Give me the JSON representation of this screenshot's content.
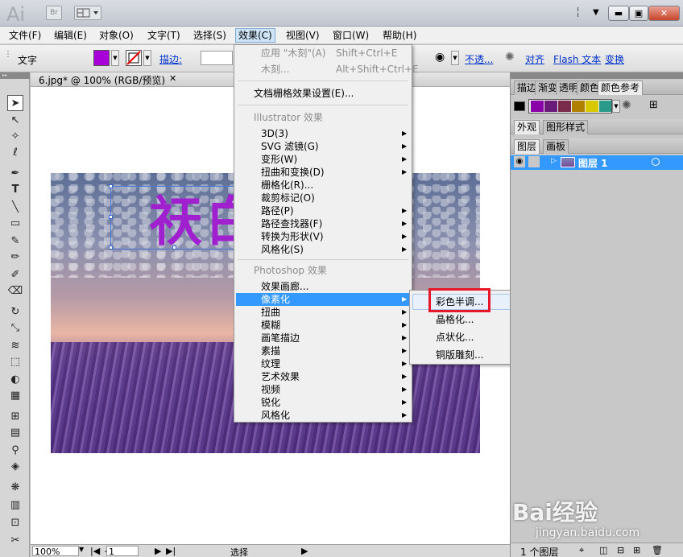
{
  "titlebar": {
    "logo": "Ai",
    "br": "Br",
    "minimize": "▬",
    "maximize": "▣",
    "close": "✕"
  },
  "menubar": [
    "文件(F)",
    "编辑(E)",
    "对象(O)",
    "文字(T)",
    "选择(S)",
    "效果(C)",
    "视图(V)",
    "窗口(W)",
    "帮助(H)"
  ],
  "control": {
    "tool": "文字",
    "stroke_label": "描边:",
    "opacity": "不透...",
    "align": "对齐",
    "flash": "Flash 文本",
    "transform": "变换",
    "fill_color": "#a800d8"
  },
  "document": {
    "tab_title": "6.jpg* @ 100% (RGB/预览)",
    "canvas_text": "祆白"
  },
  "effect_menu": {
    "top": [
      {
        "label": "应用 \"木刻\"(A)",
        "shortcut": "Shift+Ctrl+E"
      },
      {
        "label": "木刻...",
        "shortcut": "Alt+Shift+Ctrl+E"
      }
    ],
    "raster": "文档栅格效果设置(E)...",
    "ill_header": "Illustrator 效果",
    "ill_items": [
      "3D(3)",
      "SVG 滤镜(G)",
      "变形(W)",
      "扭曲和变换(D)",
      "栅格化(R)...",
      "裁剪标记(O)",
      "路径(P)",
      "路径查找器(F)",
      "转换为形状(V)",
      "风格化(S)"
    ],
    "ps_header": "Photoshop 效果",
    "ps_items": [
      "效果画廊...",
      "像素化",
      "扭曲",
      "模糊",
      "画笔描边",
      "素描",
      "纹理",
      "艺术效果",
      "视频",
      "锐化",
      "风格化"
    ]
  },
  "submenu": [
    "彩色半调...",
    "晶格化...",
    "点状化...",
    "铜版雕刻..."
  ],
  "panels": {
    "tabs1": [
      "描边",
      "渐变",
      "透明",
      "颜色",
      "颜色参考"
    ],
    "tabs2": [
      "外观",
      "图形样式"
    ],
    "tabs3": [
      "图层",
      "画板"
    ],
    "layer_name": "图层 1",
    "footer": "1 个图层",
    "swatches": [
      "#8a00a8",
      "#6a1a78",
      "#7a2a4a",
      "#b08000",
      "#d8c800",
      "#2a9a8a"
    ]
  },
  "status": {
    "zoom": "100%",
    "page": "1",
    "tool": "选择"
  },
  "watermark": {
    "brand": "Bai经验",
    "url": "jingyan.baidu.com"
  }
}
